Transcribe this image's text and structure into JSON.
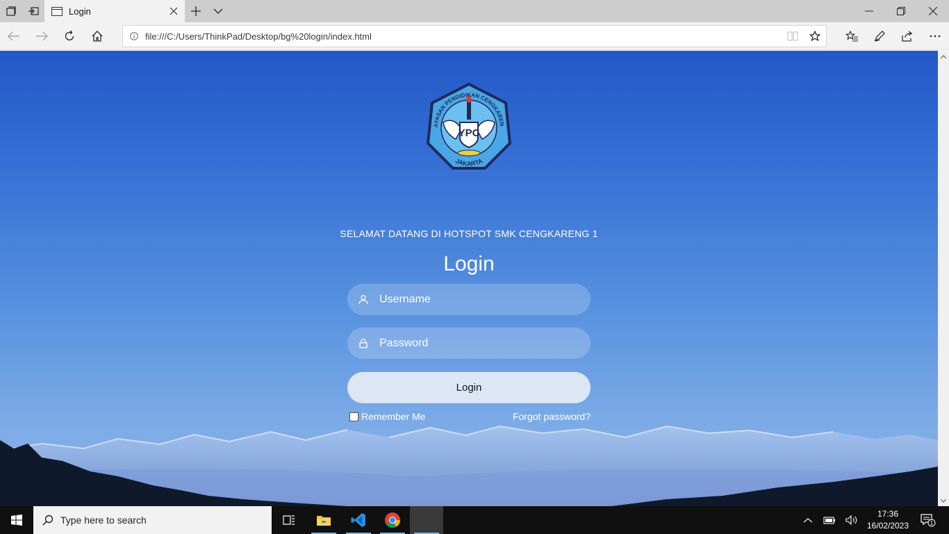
{
  "browser": {
    "tab_title": "Login",
    "url": "file:///C:/Users/ThinkPad/Desktop/bg%20login/index.html"
  },
  "page": {
    "logo": {
      "text_top": "YAYASAN PENDIDIKAN CENGKARENG",
      "monogram": "YPC",
      "text_bottom": "JAKARTA"
    },
    "welcome_text": "SELAMAT DATANG DI HOTSPOT SMK CENGKARENG 1",
    "heading": "Login",
    "username_placeholder": "Username",
    "password_placeholder": "Password",
    "login_button": "Login",
    "remember_me": "Remember Me",
    "forgot_password": "Forgot password?"
  },
  "taskbar": {
    "search_placeholder": "Type here to search",
    "time": "17:36",
    "date": "16/02/2023",
    "notification_count": "1"
  },
  "colors": {
    "sky_top": "#2258c6",
    "sky_bottom": "#8fb7ea",
    "login_button_bg": "#dde6f4",
    "logo_blue": "#4aa6e4",
    "logo_navy": "#1d2a5c"
  }
}
